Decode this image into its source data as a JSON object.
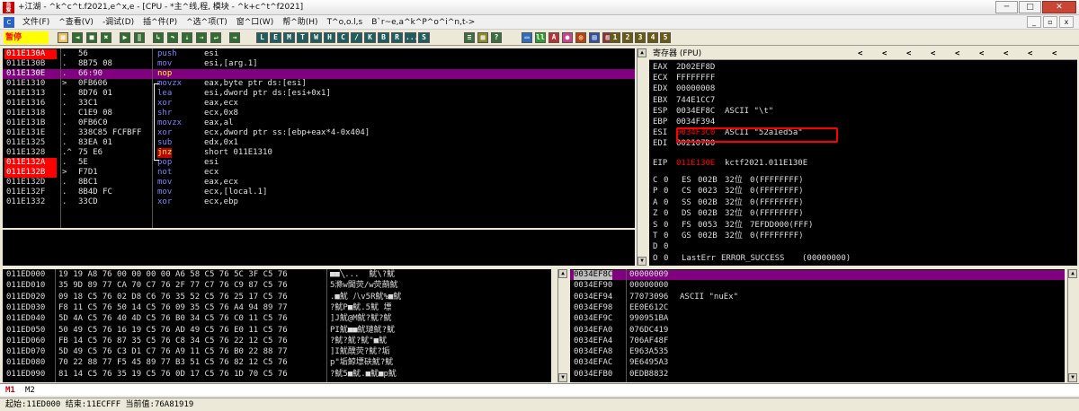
{
  "titlebar": {
    "text": "+江湖  - ^k^c^t.f2021,e^x,e - [CPU - *主^线,程, 模块 - ^k+c^t^f2021]",
    "btn_min": "─",
    "btn_max": "□",
    "btn_close": "✕"
  },
  "menubar": {
    "items": [
      "文件(F)",
      "^查看(V)",
      "-调试(D)",
      "插^件(P)",
      "^选^项(T)",
      "窗^口(W)",
      "帮^助(H)",
      "T^o,o.l,s",
      "B`r~e,a^k^P^o^i^n,t->"
    ],
    "mdi_min": "_",
    "mdi_restore": "▫",
    "mdi_close": "x"
  },
  "toolbar": {
    "pause_label": "暂停",
    "letter_buttons": [
      "L",
      "E",
      "M",
      "T",
      "W",
      "H",
      "C",
      "/",
      "K",
      "B",
      "R",
      "...",
      "S"
    ],
    "number_buttons": [
      "1",
      "2",
      "3",
      "4",
      "5"
    ]
  },
  "colors": {
    "address_red": "#ff0000",
    "selection_purple": "#800080",
    "mnemonic_blue": "#8080ff",
    "highlight_box": "#ff0000"
  },
  "disasm": [
    {
      "addr": "011E130A",
      "dot": ".",
      "hex": "56",
      "mn": "push",
      "op": "esi",
      "hl": "addr"
    },
    {
      "addr": "011E130B",
      "dot": ".",
      "hex": "8B75 08",
      "mn": "mov",
      "op": "esi,[arg.1]",
      "hl": ""
    },
    {
      "addr": "011E130E",
      "dot": ".",
      "hex": "66:90",
      "mn": "nop",
      "op": "",
      "hl": "row"
    },
    {
      "addr": "011E1310",
      "dot": ">",
      "hex": "0FB606",
      "mn": "movzx",
      "op": "eax,byte ptr ds:[esi]",
      "hl": ""
    },
    {
      "addr": "011E1313",
      "dot": ".",
      "hex": "8D76 01",
      "mn": "lea",
      "op": "esi,dword ptr ds:[esi+0x1]",
      "hl": ""
    },
    {
      "addr": "011E1316",
      "dot": ".",
      "hex": "33C1",
      "mn": "xor",
      "op": "eax,ecx",
      "hl": ""
    },
    {
      "addr": "011E1318",
      "dot": ".",
      "hex": "C1E9 08",
      "mn": "shr",
      "op": "ecx,0x8",
      "hl": ""
    },
    {
      "addr": "011E131B",
      "dot": ".",
      "hex": "0FB6C0",
      "mn": "movzx",
      "op": "eax,al",
      "hl": ""
    },
    {
      "addr": "011E131E",
      "dot": ".",
      "hex": "338C85 FCFBFF",
      "mn": "xor",
      "op": "ecx,dword ptr ss:[ebp+eax*4-0x404]",
      "hl": ""
    },
    {
      "addr": "011E1325",
      "dot": ".",
      "hex": "83EA 01",
      "mn": "sub",
      "op": "edx,0x1",
      "hl": ""
    },
    {
      "addr": "011E1328",
      "dot": ".^",
      "hex": "75 E6",
      "mn": "jnz",
      "op": "short 011E1310",
      "hl": "jump"
    },
    {
      "addr": "011E132A",
      "dot": ".",
      "hex": "5E",
      "mn": "pop",
      "op": "esi",
      "hl": "addr"
    },
    {
      "addr": "011E132B",
      "dot": ">",
      "hex": "F7D1",
      "mn": "not",
      "op": "ecx",
      "hl": "addr"
    },
    {
      "addr": "011E132D",
      "dot": ".",
      "hex": "8BC1",
      "mn": "mov",
      "op": "eax,ecx",
      "hl": ""
    },
    {
      "addr": "011E132F",
      "dot": ".",
      "hex": "8B4D FC",
      "mn": "mov",
      "op": "ecx,[local.1]",
      "hl": ""
    },
    {
      "addr": "011E1332",
      "dot": ".",
      "hex": "33CD",
      "mn": "xor",
      "op": "ecx,ebp",
      "hl": ""
    }
  ],
  "registers": {
    "header": "寄存器 (FPU)",
    "nav_arrows": [
      "<",
      "<",
      "<",
      "<",
      "<",
      "<",
      "<",
      "<",
      "<"
    ],
    "gp": [
      {
        "name": "EAX",
        "value": "2D02EF8D",
        "extra": ""
      },
      {
        "name": "ECX",
        "value": "FFFFFFFF",
        "extra": ""
      },
      {
        "name": "EDX",
        "value": "00000008",
        "extra": ""
      },
      {
        "name": "EBX",
        "value": "744E1CC7",
        "extra": ""
      },
      {
        "name": "ESP",
        "value": "0034EF8C",
        "extra": "ASCII \"\\t\""
      },
      {
        "name": "EBP",
        "value": "0034F394",
        "extra": ""
      },
      {
        "name": "ESI",
        "value": "0034F3C0",
        "extra": "ASCII \"52a1ed5a\"",
        "changed": true
      },
      {
        "name": "EDI",
        "value": "002107D0",
        "extra": ""
      }
    ],
    "eip": {
      "name": "EIP",
      "value": "011E130E",
      "extra": "kctf2021.011E130E"
    },
    "flags": [
      {
        "f": "C",
        "v": "0",
        "seg": "ES",
        "sel": "002B",
        "bits": "32位",
        "base": "0(FFFFFFFF)"
      },
      {
        "f": "P",
        "v": "0",
        "seg": "CS",
        "sel": "0023",
        "bits": "32位",
        "base": "0(FFFFFFFF)"
      },
      {
        "f": "A",
        "v": "0",
        "seg": "SS",
        "sel": "002B",
        "bits": "32位",
        "base": "0(FFFFFFFF)"
      },
      {
        "f": "Z",
        "v": "0",
        "seg": "DS",
        "sel": "002B",
        "bits": "32位",
        "base": "0(FFFFFFFF)"
      },
      {
        "f": "S",
        "v": "0",
        "seg": "FS",
        "sel": "0053",
        "bits": "32位",
        "base": "7EFDD000(FFF)"
      },
      {
        "f": "T",
        "v": "0",
        "seg": "GS",
        "sel": "002B",
        "bits": "32位",
        "base": "0(FFFFFFFF)"
      },
      {
        "f": "D",
        "v": "0",
        "seg": "",
        "sel": "",
        "bits": "",
        "base": ""
      },
      {
        "f": "O",
        "v": "0",
        "seg": "LastErr",
        "sel": "ERROR_SUCCESS",
        "bits": "",
        "base": "(00000000)"
      }
    ]
  },
  "dump": [
    {
      "addr": "011ED000",
      "hex": "19 19 A8 76 00 00 00 00 A6 58 C5 76 5C 3F C5 76",
      "ascii": "■■╲...  魷\\?魷"
    },
    {
      "addr": "011ED010",
      "hex": "35 9D 89 77 CA 70 C7 76 2F 77 C7 76 C9 87 C5 76",
      "ascii": "5滌w閭荧/w荧蓢魷"
    },
    {
      "addr": "011ED020",
      "hex": "09 18 C5 76 02 D8 C6 76 35 52 C5 76 25 17 C5 76",
      "ascii": ".■魷 八v5R魷%■魷"
    },
    {
      "addr": "011ED030",
      "hex": "F8 11 C5 76 50 14 C5 76 09 35 C5 76 A4 94 89 77",
      "ascii": "?魷P■魷.5魷 墂"
    },
    {
      "addr": "011ED040",
      "hex": "5D 4A C5 76 40 4D C5 76 B0 34 C5 76 C0 11 C5 76",
      "ascii": "]J魷@M魷?魷?魷"
    },
    {
      "addr": "011ED050",
      "hex": "50 49 C5 76 16 19 C5 76 AD 49 C5 76 E0 11 C5 76",
      "ascii": "PI魷■■魷璉魷?魷"
    },
    {
      "addr": "011ED060",
      "hex": "FB 14 C5 76 87 35 C5 76 C8 34 C5 76 22 12 C5 76",
      "ascii": "?魷?魷?魷\"■魷"
    },
    {
      "addr": "011ED070",
      "hex": "5D 49 C5 76 C3 D1 C7 76 A9 11 C5 76 B0 22 88 77",
      "ascii": "]I魷醭荧?魷?垢"
    },
    {
      "addr": "011ED080",
      "hex": "70 22 88 77 F5 45 89 77 B3 51 C5 76 82 12 C5 76",
      "ascii": "p\"垢鯨墂砆魷?魷"
    },
    {
      "addr": "011ED090",
      "hex": "81 14 C5 76 35 19 C5 76 0D 17 C5 76 1D 70 C5 76",
      "ascii": "?魷5■魷.■魷■p魷"
    }
  ],
  "stack": [
    {
      "addr": "0034EF8C",
      "value": "00000009",
      "comment": "",
      "selected": true
    },
    {
      "addr": "0034EF90",
      "value": "00000000",
      "comment": ""
    },
    {
      "addr": "0034EF94",
      "value": "77073096",
      "comment": "ASCII \"nuEx\""
    },
    {
      "addr": "0034EF98",
      "value": "EE0E612C",
      "comment": ""
    },
    {
      "addr": "0034EF9C",
      "value": "990951BA",
      "comment": ""
    },
    {
      "addr": "0034EFA0",
      "value": "076DC419",
      "comment": ""
    },
    {
      "addr": "0034EFA4",
      "value": "706AF48F",
      "comment": ""
    },
    {
      "addr": "0034EFA8",
      "value": "E963A535",
      "comment": ""
    },
    {
      "addr": "0034EFAC",
      "value": "9E6495A3",
      "comment": ""
    },
    {
      "addr": "0034EFB0",
      "value": "0EDB8832",
      "comment": ""
    }
  ],
  "tabs": {
    "m1": "M1",
    "m2": "M2"
  },
  "statusbar": {
    "text": "起始:11ED000 结束:11ECFFF 当前值:76A81919"
  }
}
